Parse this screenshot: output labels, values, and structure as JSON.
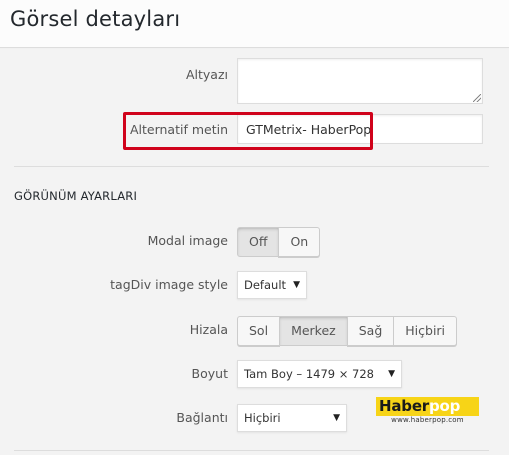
{
  "header": {
    "title": "Görsel detayları"
  },
  "form": {
    "caption_label": "Altyazı",
    "caption_value": "",
    "alt_label": "Alternatif metin",
    "alt_value": "GTMetrix- HaberPop"
  },
  "display_settings": {
    "section_title": "GÖRÜNÜM AYARLARI",
    "modal_label": "Modal image",
    "modal_options": [
      "Off",
      "On"
    ],
    "modal_selected": "Off",
    "style_label": "tagDiv image style",
    "style_value": "Default",
    "align_label": "Hizala",
    "align_options": [
      "Sol",
      "Merkez",
      "Sağ",
      "Hiçbiri"
    ],
    "align_selected": "Merkez",
    "size_label": "Boyut",
    "size_value": "Tam Boy – 1479 × 728",
    "link_label": "Bağlantı",
    "link_value": "Hiçbiri"
  },
  "watermark": {
    "brand_dark": "Haber",
    "brand_light": "pop",
    "url": "www.haberpop.com",
    "brand_color": "#f7d417"
  },
  "colors": {
    "highlight": "#d0021b"
  }
}
